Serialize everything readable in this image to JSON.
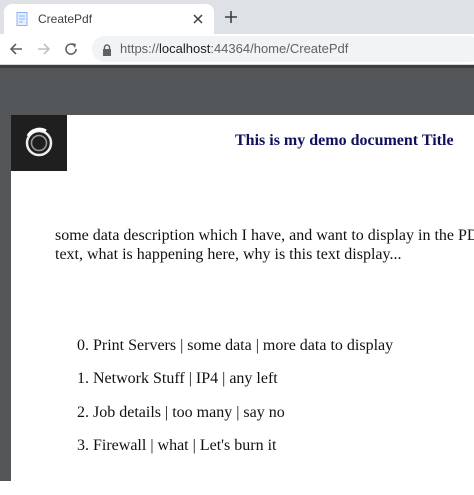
{
  "tab": {
    "title": "CreatePdf"
  },
  "address_bar": {
    "scheme": "https://",
    "host": "localhost",
    "rest": ":44364/home/CreatePdf"
  },
  "document": {
    "title": "This is my demo document Title",
    "description_lines": [
      "some data description which I have, and want to display in the PDF",
      "text, what is happening here, why is this text display..."
    ],
    "items": [
      "0. Print Servers | some data | more data to display",
      "1. Network Stuff | IP4 | any left",
      "2. Job details | too many | say no",
      "3. Firewall | what | Let's burn it"
    ]
  }
}
